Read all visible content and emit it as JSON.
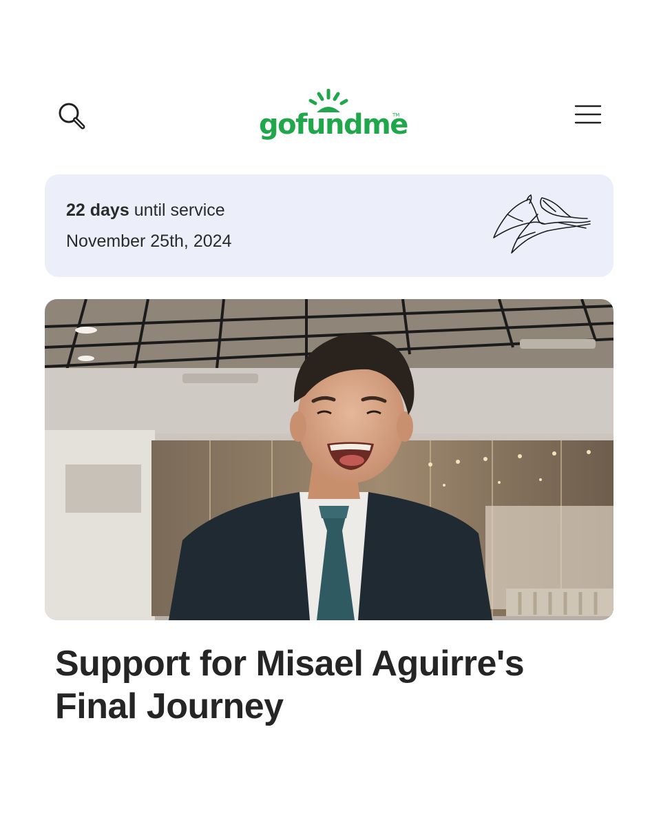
{
  "header": {
    "logo_text": "gofundme",
    "logo_tm": "TM",
    "search_icon": "search-icon",
    "menu_icon": "hamburger-menu-icon",
    "brand_color": "#20a74b"
  },
  "service": {
    "days_count": "22 days",
    "days_suffix": " until service",
    "date": "November 25th, 2024",
    "card_color": "#eceff9",
    "illustration": "calla-lily-icon"
  },
  "hero": {
    "image": "portrait-photo-smiling-man-in-suit"
  },
  "campaign": {
    "title_line1": "Support for Misael Aguirre's",
    "title_line2": "Final Journey"
  }
}
